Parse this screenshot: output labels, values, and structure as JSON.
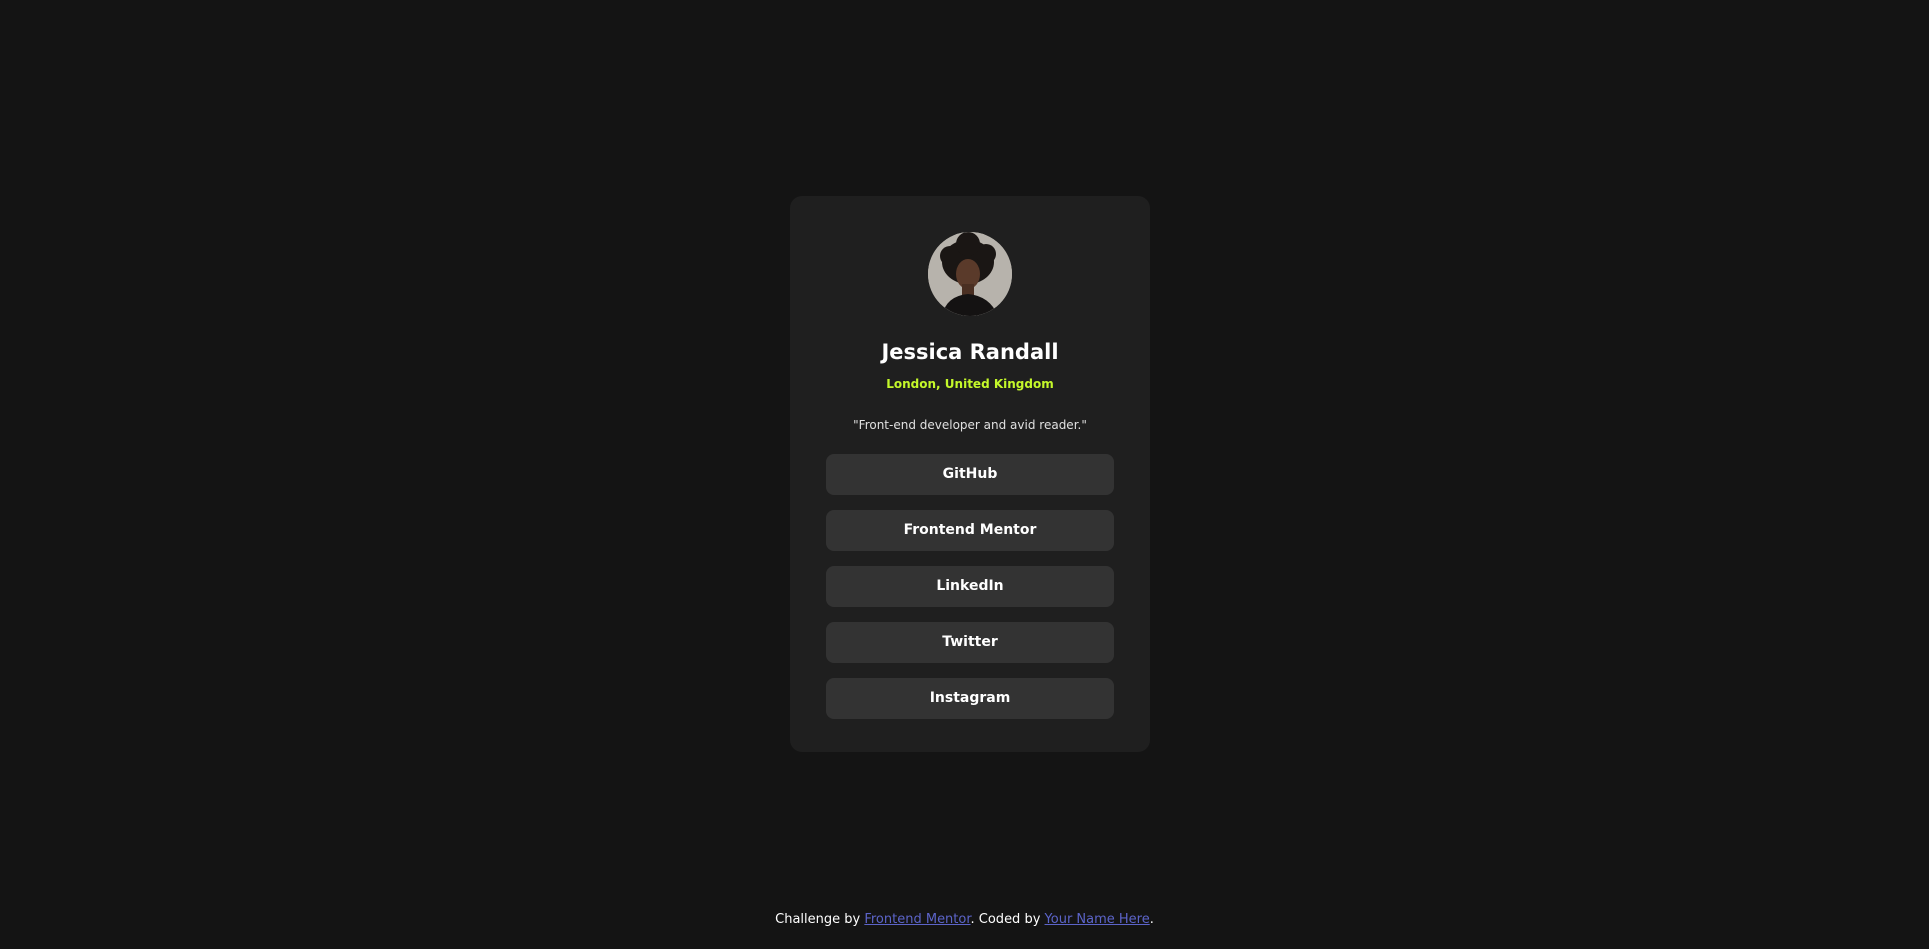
{
  "profile": {
    "name": "Jessica Randall",
    "location": "London, United Kingdom",
    "bio": "\"Front-end developer and avid reader.\"",
    "avatar_icon": "profile-photo"
  },
  "links": [
    {
      "label": "GitHub"
    },
    {
      "label": "Frontend Mentor"
    },
    {
      "label": "LinkedIn"
    },
    {
      "label": "Twitter"
    },
    {
      "label": "Instagram"
    }
  ],
  "attribution": {
    "prefix": "Challenge by ",
    "challenge_link": "Frontend Mentor",
    "middle": ". Coded by ",
    "author_link": "Your Name Here",
    "suffix": "."
  },
  "colors": {
    "background": "#141414",
    "card": "#1f1f1f",
    "button": "#333333",
    "accent": "#c4f82a",
    "link": "#5c64c9"
  }
}
